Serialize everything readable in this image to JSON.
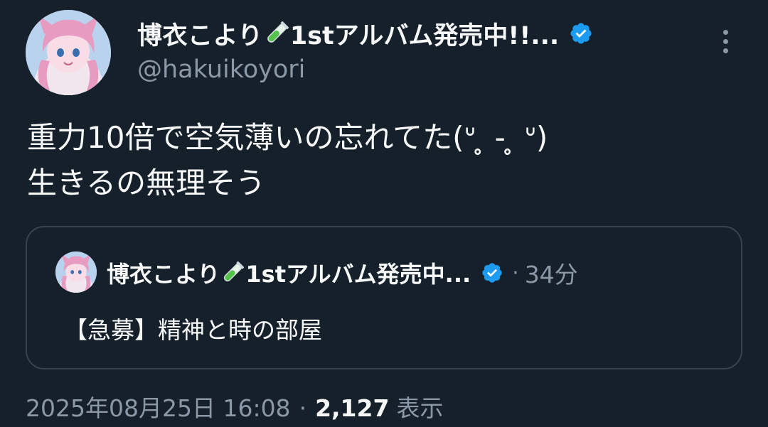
{
  "author": {
    "name_part1": "博衣こより",
    "name_part2": "1stアルバム発売中!!...",
    "handle": "@hakuikoyori",
    "verified": true,
    "emoji": "test-tube-icon"
  },
  "tweet": {
    "line1": "重力10倍で空気薄いの忘れてた(ᐡ ̥ - ̥ ᐡ)",
    "line2": "生きるの無理そう"
  },
  "quote": {
    "name_part1": "博衣こより",
    "name_part2": "1stアルバム発売中...",
    "separator": "·",
    "time": "34分",
    "text": "【急募】精神と時の部屋"
  },
  "meta": {
    "datetime": "2025年08月25日 16:08",
    "separator": "·",
    "views_count": "2,127",
    "views_label": "表示"
  },
  "colors": {
    "background": "#15202b",
    "text": "#f7f9f9",
    "secondary": "#8b98a5",
    "verified": "#1d9bf0",
    "border": "#38444d"
  }
}
